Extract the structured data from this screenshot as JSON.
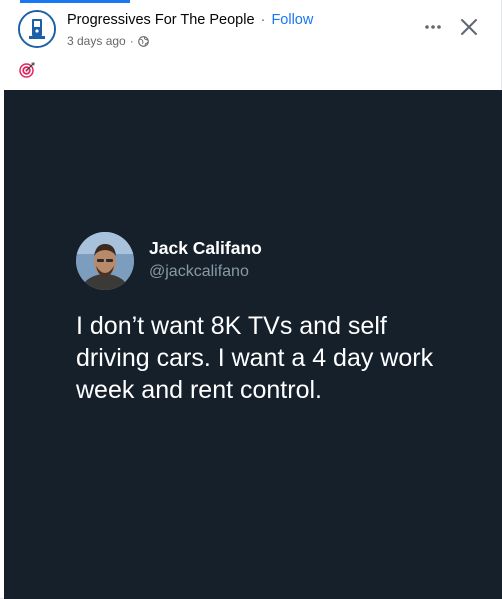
{
  "post": {
    "page_name": "Progressives For The People",
    "separator": "·",
    "follow_label": "Follow",
    "time": "3 days ago",
    "time_separator": "·",
    "emoji": "🎯"
  },
  "icons": {
    "more": "more-horizontal-icon",
    "close": "close-icon",
    "privacy": "globe-icon",
    "avatar": "page-logo-icon"
  },
  "tweet": {
    "name": "Jack Califano",
    "handle": "@jackcalifano",
    "text": "I don’t want 8K TVs and self driving cars. I want a 4 day work week and rent control."
  },
  "colors": {
    "accent": "#1877f2",
    "tweet_background": "#15202b",
    "handle": "#8899a6",
    "meta_text": "#65676b"
  }
}
